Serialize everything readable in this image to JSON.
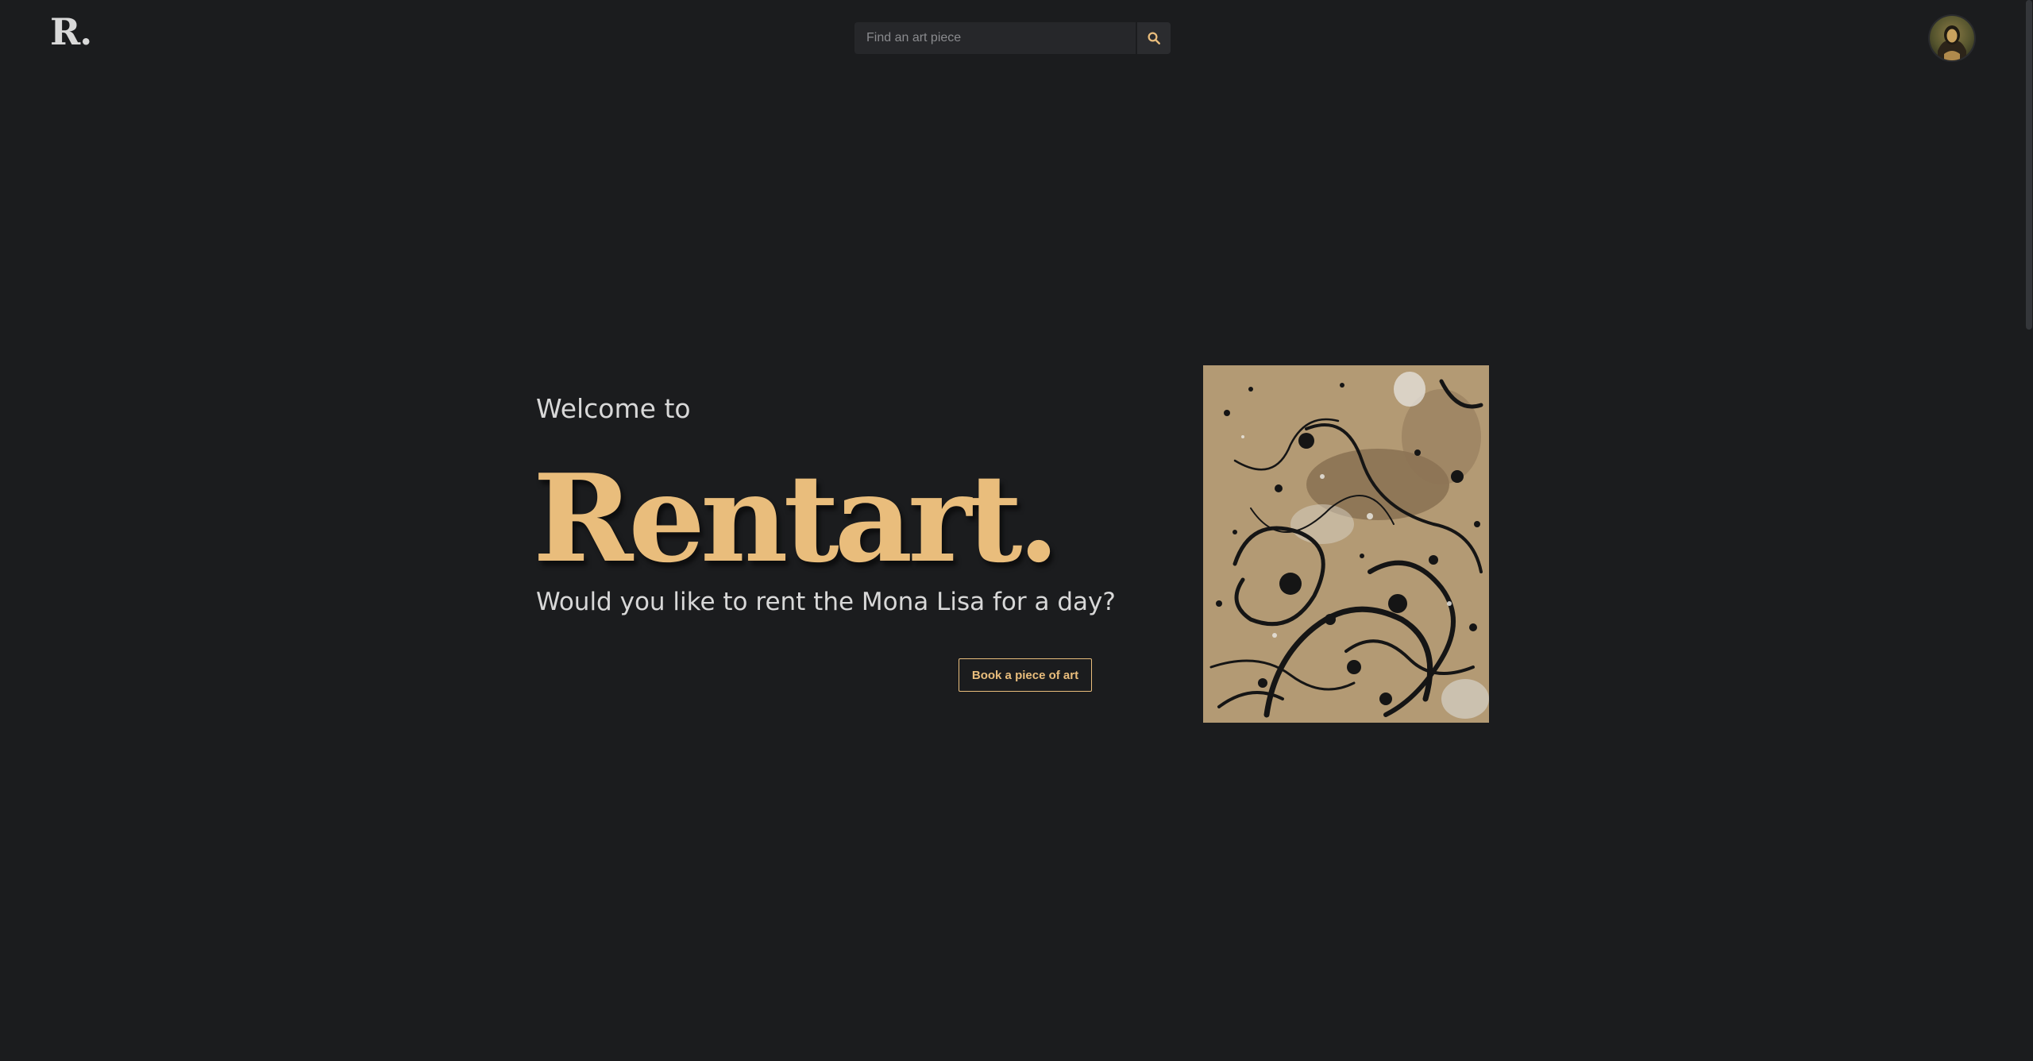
{
  "header": {
    "logo_text": "R.",
    "search": {
      "placeholder": "Find an art piece",
      "value": "",
      "button_icon": "search-icon"
    },
    "avatar_icon": "avatar-mona-lisa"
  },
  "hero": {
    "welcome": "Welcome to",
    "brand": "Rentart.",
    "tagline": "Would you like to rent the Mona Lisa for a day?",
    "cta_label": "Book a piece of art",
    "artwork_icon": "abstract-splatter-painting"
  },
  "colors": {
    "background": "#1b1c1e",
    "accent": "#e9bd7c",
    "text": "#d8d8d8",
    "search_bg": "#26272a"
  }
}
